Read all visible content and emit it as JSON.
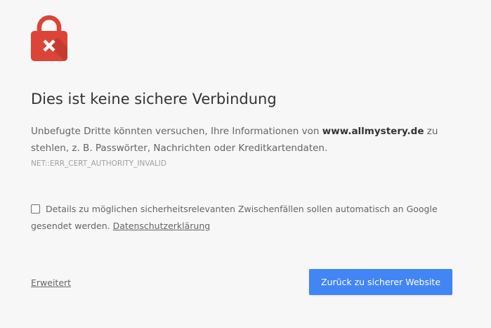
{
  "icon": {
    "name": "lock-error-icon",
    "color": "#db4437",
    "shadow_color": "#b5352b",
    "mark_color": "#ffffff"
  },
  "interstitial": {
    "title": "Dies ist keine sichere Verbindung",
    "explanation_before": "Unbefugte Dritte könnten versuchen, Ihre Informationen von ",
    "domain": "www.allmystery.de",
    "explanation_after": " zu stehlen, z. B. Passwörter, Nachrichten oder Kreditkartendaten.",
    "error_code": "NET::ERR_CERT_AUTHORITY_INVALID"
  },
  "reporting": {
    "checked": false,
    "label": "Details zu möglichen sicherheitsrelevanten Zwischenfällen sollen automatisch an Google gesendet werden. ",
    "privacy_link": "Datenschutzerklärung"
  },
  "actions": {
    "advanced_label": "Erweitert",
    "back_button_label": "Zurück zu sicherer Website"
  },
  "colors": {
    "background": "#f7f7f7",
    "primary_button": "#4285f4",
    "title_text": "#333333",
    "body_text": "#646464",
    "error_code_text": "#a0a0a0"
  }
}
